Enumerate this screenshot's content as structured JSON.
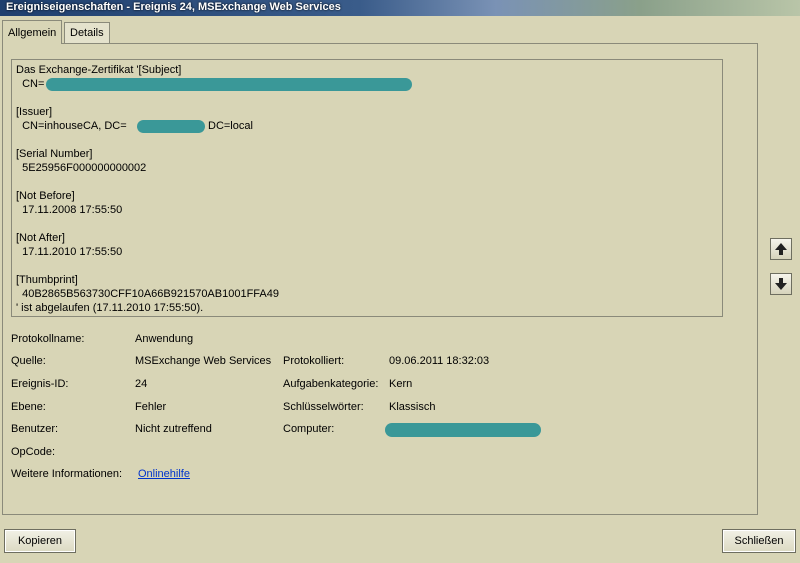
{
  "window": {
    "title": "Ereigniseigenschaften - Ereignis 24, MSExchange Web Services"
  },
  "tabs": [
    {
      "label": "Allgemein"
    },
    {
      "label": "Details"
    }
  ],
  "message": {
    "lines": [
      "Das Exchange-Zertifikat '[Subject]",
      "  CN=",
      "",
      "[Issuer]",
      "  CN=inhouseCA, DC=",
      "",
      "[Serial Number]",
      "  5E25956F000000000002",
      "",
      "[Not Before]",
      "  17.11.2008 17:55:50",
      "",
      "[Not After]",
      "  17.11.2010 17:55:50",
      "",
      "[Thumbprint]",
      "  40B2865B563730CFF10A66B921570AB1001FFA49",
      "' ist abgelaufen (17.11.2010 17:55:50)."
    ],
    "issuer_tail": "DC=local"
  },
  "fields": {
    "protokollname_label": "Protokollname:",
    "protokollname_value": "Anwendung",
    "quelle_label": "Quelle:",
    "quelle_value": "MSExchange Web Services",
    "protokolliert_label": "Protokolliert:",
    "protokolliert_value": "09.06.2011 18:32:03",
    "ereignis_label": "Ereignis-ID:",
    "ereignis_value": "24",
    "aufgaben_label": "Aufgabenkategorie:",
    "aufgaben_value": "Kern",
    "ebene_label": "Ebene:",
    "ebene_value": "Fehler",
    "schluessel_label": "Schlüsselwörter:",
    "schluessel_value": "Klassisch",
    "benutzer_label": "Benutzer:",
    "benutzer_value": "Nicht zutreffend",
    "computer_label": "Computer:",
    "opcode_label": "OpCode:",
    "weitere_label": "Weitere Informationen:",
    "weitere_link": "Onlinehilfe"
  },
  "buttons": {
    "copy": "Kopieren",
    "close": "Schließen"
  },
  "icons": {
    "up": "arrow-up-icon",
    "down": "arrow-down-icon"
  },
  "colors": {
    "redaction": "#3a9898",
    "link": "#0033cc",
    "background": "#d8d5b6"
  }
}
